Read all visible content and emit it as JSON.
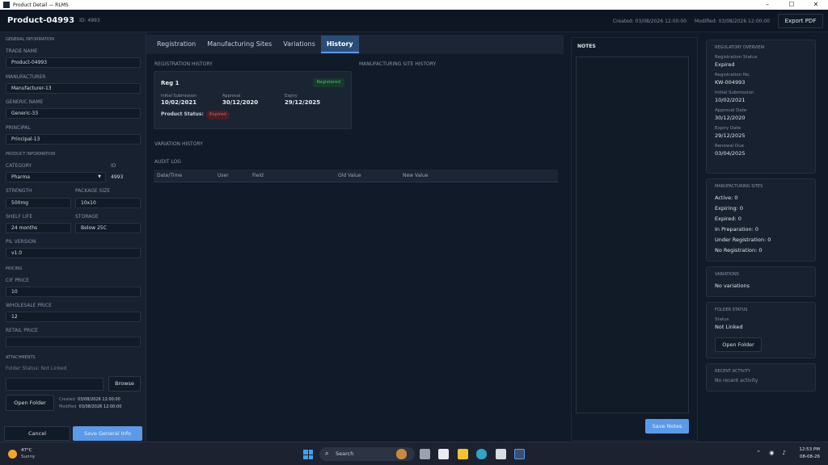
{
  "window": {
    "title": "Product Detail — RLMS",
    "minimize": "–",
    "maximize": "☐",
    "close": "✕"
  },
  "header": {
    "product_title": "Product-04993",
    "product_id": "ID: 4993",
    "created": "Created: 03/08/2026 12:00:00",
    "modified": "Modified: 03/08/2026 12:00:00",
    "export_label": "Export PDF"
  },
  "left": {
    "general_section": "GENERAL INFORMATION",
    "trade_name_label": "TRADE NAME",
    "trade_name": "Product-04993",
    "manufacturer_label": "MANUFACTURER",
    "manufacturer": "Manufacturer-13",
    "generic_name_label": "GENERIC NAME",
    "generic_name": "Generic-33",
    "principal_label": "PRINCIPAL",
    "principal": "Principal-13",
    "product_section": "PRODUCT INFORMATION",
    "category_label": "CATEGORY",
    "category": "Pharma",
    "id_label": "ID",
    "id_value": "4993",
    "strength_label": "STRENGTH",
    "strength": "500mg",
    "package_size_label": "PACKAGE SIZE",
    "package_size": "10x10",
    "shelf_life_label": "SHELF LIFE",
    "shelf_life": "24 months",
    "storage_label": "STORAGE",
    "storage": "Below 25C",
    "pil_version_label": "PIL VERSION",
    "pil_version": "v1.0",
    "pricing_section": "PRICING",
    "cif_price_label": "CIF PRICE",
    "cif_price": "10",
    "wholesale_price_label": "WHOLESALE PRICE",
    "wholesale_price": "12",
    "retail_price_label": "RETAIL PRICE",
    "retail_price": "",
    "attachments_section": "ATTACHMENTS",
    "folder_status": "Folder Status: Not Linked",
    "browse_label": "Browse",
    "open_folder_label": "Open Folder",
    "created_key": "Created",
    "created_value": "03/08/2026 12:00:00",
    "modified_key": "Modified",
    "modified_value": "03/08/2026 12:00:00",
    "cancel_label": "Cancel",
    "save_label": "Save General Info"
  },
  "tabs": [
    {
      "label": "Registration"
    },
    {
      "label": "Manufacturing Sites"
    },
    {
      "label": "Variations"
    },
    {
      "label": "History"
    }
  ],
  "history": {
    "registration_history": "REGISTRATION HISTORY",
    "manufacturing_site_history": "MANUFACTURING SITE HISTORY",
    "reg": {
      "name": "Reg 1",
      "status_badge": "Registered",
      "initial_label": "Initial Submission",
      "initial_value": "10/02/2021",
      "approval_label": "Approval",
      "approval_value": "30/12/2020",
      "expiry_label": "Expiry",
      "expiry_value": "29/12/2025",
      "product_status_label": "Product Status:",
      "product_status": "Expired"
    },
    "variation_history": "VARIATION HISTORY",
    "audit_log": "AUDIT LOG",
    "audit_columns": [
      "Date/Time",
      "User",
      "Field",
      "Old Value",
      "New Value"
    ]
  },
  "notes": {
    "title": "NOTES",
    "value": "",
    "save_label": "Save Notes"
  },
  "overview": {
    "title": "REGULATORY OVERVIEW",
    "registration_status_label": "Registration Status",
    "registration_status": "Expired",
    "registration_no_label": "Registration No.",
    "registration_no": "KW-004993",
    "initial_submission_label": "Initial Submission",
    "initial_submission": "10/02/2021",
    "approval_date_label": "Approval Date",
    "approval_date": "30/12/2020",
    "expiry_date_label": "Expiry Date",
    "expiry_date": "29/12/2025",
    "renewal_due_label": "Renewal Due",
    "renewal_due": "03/04/2025"
  },
  "mfg_sites": {
    "title": "MANUFACTURING SITES",
    "lines": [
      "Active: 0",
      "Expiring: 0",
      "Expired: 0",
      "In Preparation: 0",
      "Under Registration: 0",
      "No Registration: 0"
    ]
  },
  "variations": {
    "title": "VARIATIONS",
    "value": "No variations"
  },
  "folder": {
    "title": "FOLDER STATUS",
    "status_label": "Status",
    "status": "Not Linked",
    "open_label": "Open Folder"
  },
  "activity": {
    "title": "RECENT ACTIVITY",
    "value": "No recent activity"
  },
  "taskbar": {
    "temp": "47°C",
    "condition": "Sunny",
    "search_label": "Search",
    "time": "12:53 PM",
    "date": "08-08-26"
  },
  "colors": {
    "accent": "#5b9ae8",
    "registered": "#41c27b",
    "expired": "#e05a68",
    "background": "#111a28"
  }
}
